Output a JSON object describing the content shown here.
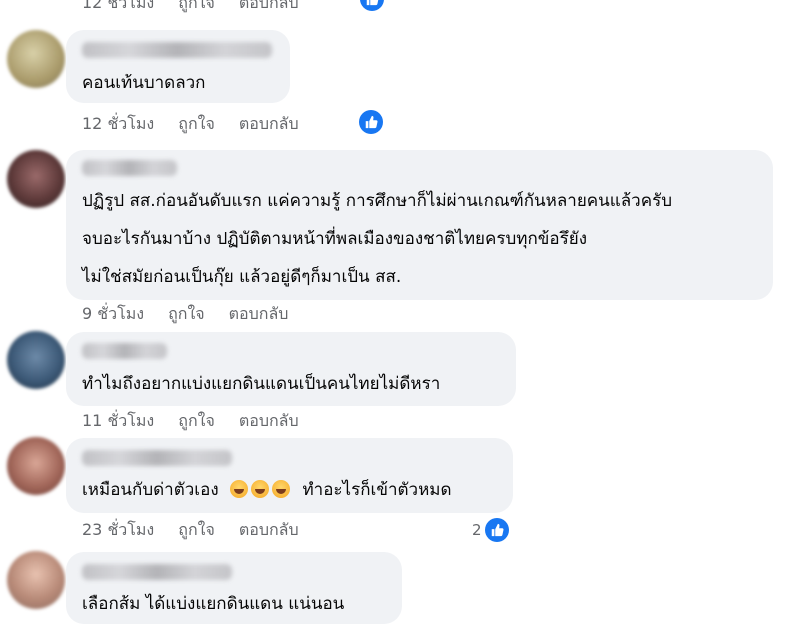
{
  "colors": {
    "bubble": "#f0f2f5",
    "meta": "#65676b",
    "like_blue": "#1877f2"
  },
  "top_row": {
    "time": "12 ชั่วโมง",
    "like": "ถูกใจ",
    "reply": "ตอบกลับ",
    "has_like_badge": true
  },
  "comments": [
    {
      "lines": [
        "คอนเท้นบาดลวก"
      ],
      "time": "12 ชั่วโมง",
      "like": "ถูกใจ",
      "reply": "ตอบกลับ",
      "has_like_badge": true
    },
    {
      "lines": [
        "ปฏิรูป สส.ก่อนอันดับแรก แค่ความรู้ การศึกษาก็ไม่ผ่านเกณฑ์กันหลายคนแล้วครับ",
        "จบอะไรกันมาบ้าง ปฏิบัติตามหน้าที่พลเมืองของชาติไทยครบทุกข้อรึยัง",
        "ไม่ใช่สมัยก่อนเป็นกุ๊ย แล้วอยู่ดีๆก็มาเป็น สส."
      ],
      "time": "9 ชั่วโมง",
      "like": "ถูกใจ",
      "reply": "ตอบกลับ"
    },
    {
      "lines": [
        "ทำไมถึงอยากแบ่งแยกดินแดนเป็นคนไทยไม่ดีหรา"
      ],
      "time": "11 ชั่วโมง",
      "like": "ถูกใจ",
      "reply": "ตอบกลับ"
    },
    {
      "text_before": "เหมือนกับด่าตัวเอง",
      "emoji_name": "rolling-on-floor-laughing-emoji",
      "text_after": "ทำอะไรก็เข้าตัวหมด",
      "time": "23 ชั่วโมง",
      "like": "ถูกใจ",
      "reply": "ตอบกลับ",
      "reaction_count": "2"
    },
    {
      "lines": [
        "เลือกส้ม ได้แบ่งแยกดินแดน แน่นอน"
      ]
    }
  ]
}
